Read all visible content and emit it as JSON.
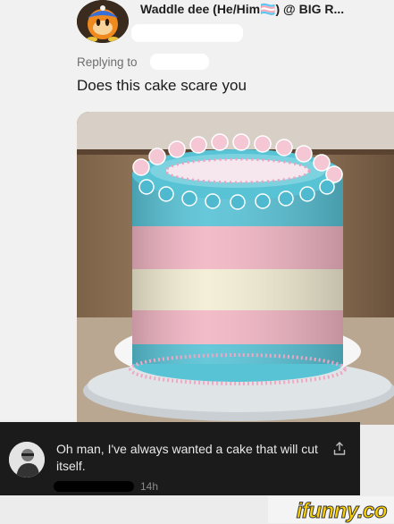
{
  "tweet": {
    "author_name": "Waddle dee (He/Him🏳️‍⚧️) @ BIG R...",
    "replying_to_label": "Replying to",
    "text": "Does this cake scare you"
  },
  "comment": {
    "text": "Oh man, I've always wanted a cake that will cut itself.",
    "time": "14h"
  },
  "watermark": "ifunny.co",
  "colors": {
    "cake_blue": "#59c3d6",
    "cake_pink": "#f2b6c4",
    "cake_cream": "#f3eed4",
    "comment_bg": "#1b1b1b",
    "watermark_yellow": "#ffd200"
  },
  "icons": {
    "share": "share-icon",
    "author_avatar": "waddle-dee-avatar",
    "commenter_avatar": "user-avatar"
  }
}
